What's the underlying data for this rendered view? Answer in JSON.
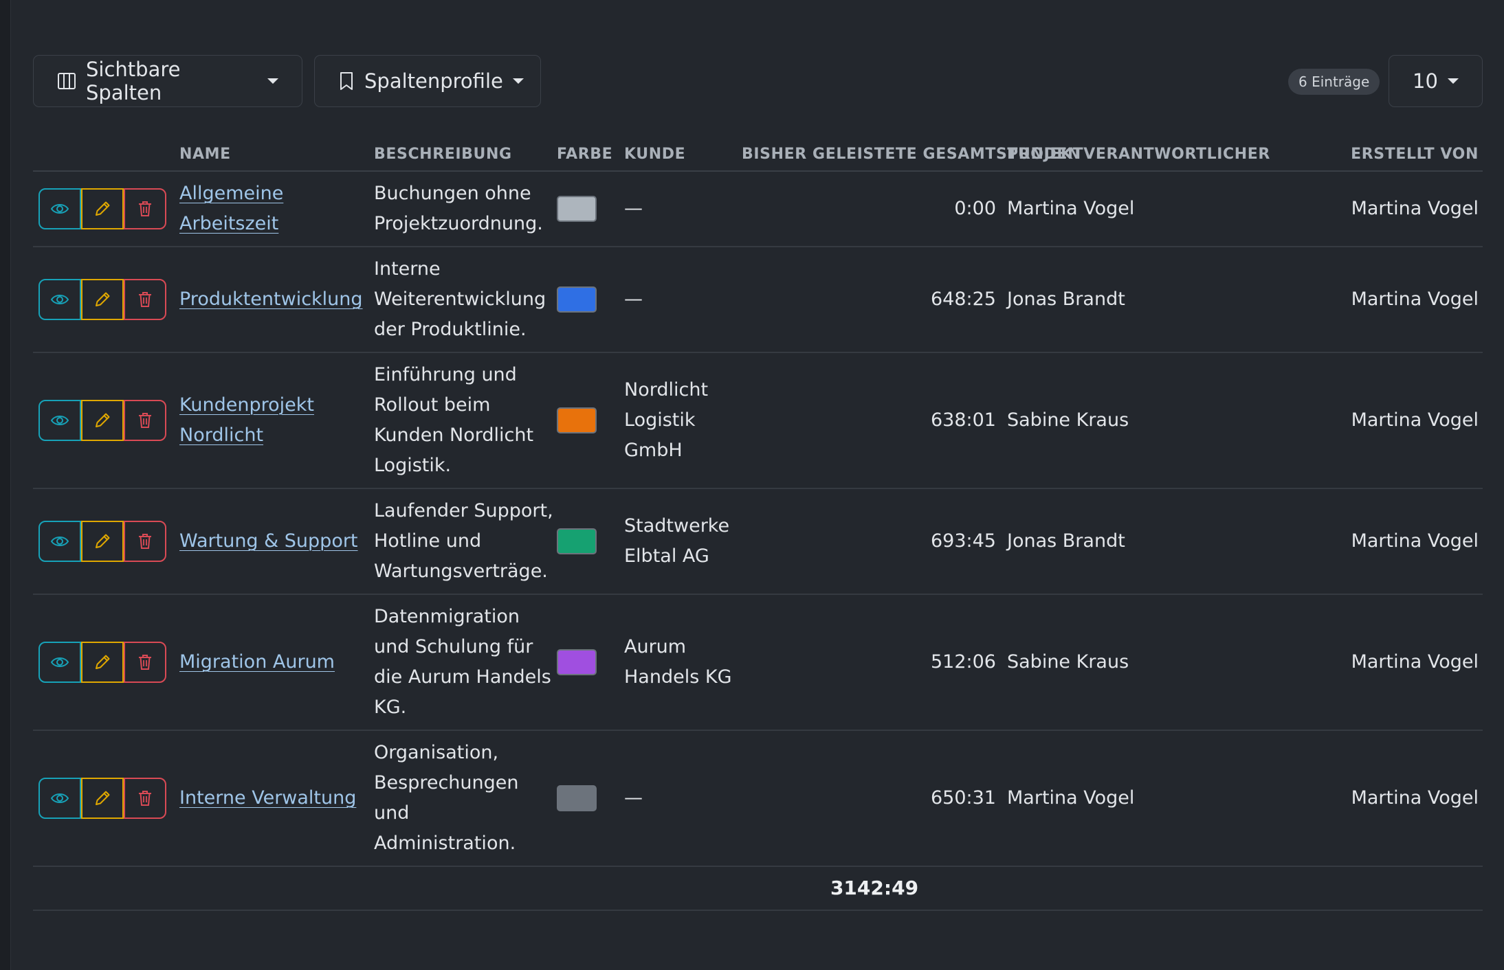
{
  "toolbar": {
    "columns_label": "Sichtbare Spalten",
    "profiles_label": "Spaltenprofile",
    "entries_badge": "6 Einträge",
    "per_page": "10"
  },
  "columns": {
    "name": "NAME",
    "description": "BESCHREIBUNG",
    "color": "FARBE",
    "client": "KUNDE",
    "hours": "BISHER GELEISTETE GESAMTSTUNDEN",
    "responsible": "PROJEKTVERANTWORTLICHER",
    "created_by": "ERSTELLT VON"
  },
  "rows": [
    {
      "name": "Allgemeine Arbeitszeit",
      "description": "Buchungen ohne Projektzuordnung.",
      "color": "#adb5bd",
      "client": "—",
      "hours": "0:00",
      "responsible": "Martina Vogel",
      "created_by": "Martina Vogel"
    },
    {
      "name": "Produktentwicklung",
      "description": "Interne Weiterentwicklung der Produktlinie.",
      "color": "#2f6fe4",
      "client": "—",
      "hours": "648:25",
      "responsible": "Jonas Brandt",
      "created_by": "Martina Vogel"
    },
    {
      "name": "Kundenprojekt Nordlicht",
      "description": "Einführung und Rollout beim Kunden Nordlicht Logistik.",
      "color": "#e8720c",
      "client": "Nordlicht Logistik GmbH",
      "hours": "638:01",
      "responsible": "Sabine Kraus",
      "created_by": "Martina Vogel"
    },
    {
      "name": "Wartung & Support",
      "description": "Laufender Support, Hotline und Wartungsverträge.",
      "color": "#16a171",
      "client": "Stadtwerke Elbtal AG",
      "hours": "693:45",
      "responsible": "Jonas Brandt",
      "created_by": "Martina Vogel"
    },
    {
      "name": "Migration Aurum",
      "description": "Datenmigration und Schulung für die Aurum Handels KG.",
      "color": "#a04fe0",
      "client": "Aurum Handels KG",
      "hours": "512:06",
      "responsible": "Sabine Kraus",
      "created_by": "Martina Vogel"
    },
    {
      "name": "Interne Verwaltung",
      "description": "Organisation, Besprechungen und Administration.",
      "color": "#6c737c",
      "client": "—",
      "hours": "650:31",
      "responsible": "Martina Vogel",
      "created_by": "Martina Vogel"
    }
  ],
  "footer": {
    "total_hours": "3142:49"
  },
  "colors": {
    "view": "#17a2b8",
    "edit": "#e0a800",
    "delete": "#d94a55",
    "link": "#9fc5e8"
  },
  "icons": {
    "view": "eye-icon",
    "edit": "pencil-icon",
    "delete": "trash-icon",
    "columns": "columns-icon",
    "profiles": "bookmark-icon"
  }
}
